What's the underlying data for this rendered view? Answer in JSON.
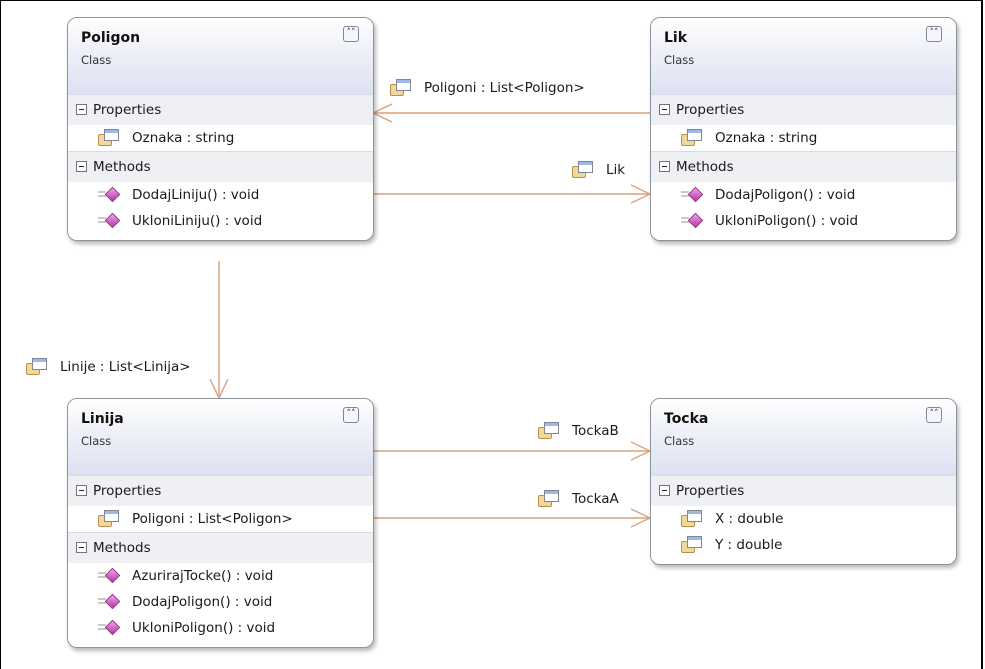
{
  "diagram": {
    "classes": {
      "poligon": {
        "name": "Poligon",
        "stereotype": "Class",
        "properties_header": "Properties",
        "properties": [
          "Oznaka : string"
        ],
        "methods_header": "Methods",
        "methods": [
          "DodajLiniju() : void",
          "UkloniLiniju() : void"
        ]
      },
      "lik": {
        "name": "Lik",
        "stereotype": "Class",
        "properties_header": "Properties",
        "properties": [
          "Oznaka : string"
        ],
        "methods_header": "Methods",
        "methods": [
          "DodajPoligon() : void",
          "UkloniPoligon() : void"
        ]
      },
      "linija": {
        "name": "Linija",
        "stereotype": "Class",
        "properties_header": "Properties",
        "properties": [
          "Poligoni : List<Poligon>"
        ],
        "methods_header": "Methods",
        "methods": [
          "AzurirajTocke() : void",
          "DodajPoligon() : void",
          "UkloniPoligon() : void"
        ]
      },
      "tocka": {
        "name": "Tocka",
        "stereotype": "Class",
        "properties_header": "Properties",
        "properties": [
          "X : double",
          "Y : double"
        ]
      }
    },
    "associations": {
      "lik_to_poligon": "Poligoni : List<Poligon>",
      "poligon_to_lik": "Lik",
      "poligon_to_linija": "Linije : List<Linija>",
      "linija_to_tocka_b": "TockaB",
      "linija_to_tocka_a": "TockaA"
    },
    "icons": {
      "collapse": "double-chevron-up-icon",
      "section": "minus-box-icon",
      "property": "property-icon",
      "method": "method-icon"
    },
    "colors": {
      "association_line": "#d7a37f",
      "header_gradient_end": "#dde1f1",
      "section_background": "#eef0f4",
      "border": "#8e949e"
    }
  }
}
